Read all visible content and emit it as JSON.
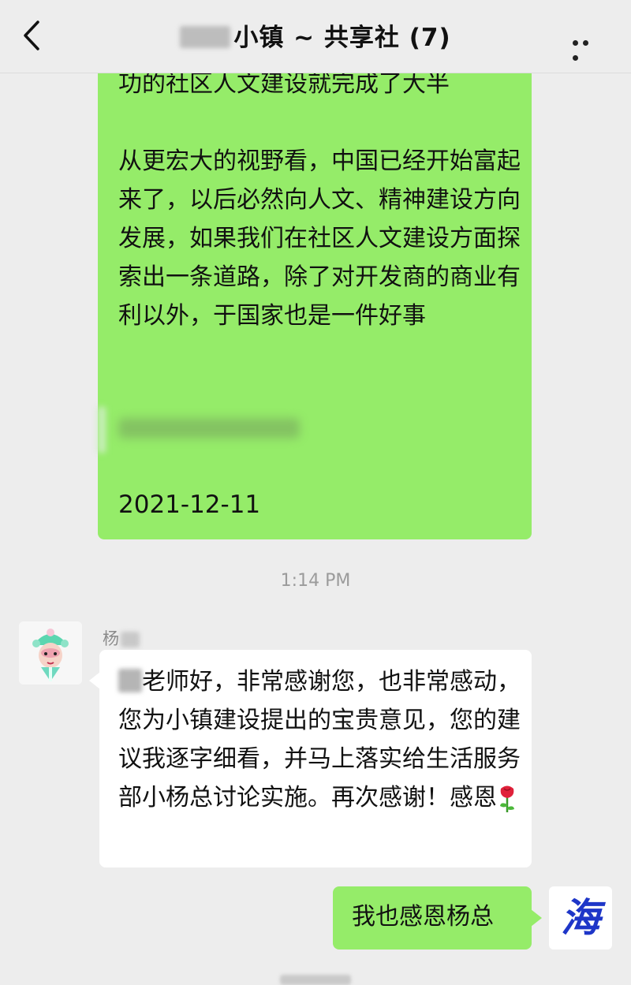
{
  "header": {
    "title": "小镇 ~ 共享社 (7)",
    "back_icon": "chevron-left-icon",
    "more_icon": "more-horizontal-icon"
  },
  "messages": {
    "forwarded": {
      "text": "功的社区人文建设就完成了大半\n\n从更宏大的视野看，中国已经开始富起来了，以后必然向人文、精神建设方向发展，如果我们在社区人文建设方面探索出一条道路，除了对开发商的商业有利以外，于国家也是一件好事",
      "date": "2021-12-11"
    },
    "time": "1:14 PM",
    "reply": {
      "sender": "杨",
      "text": "老师好，非常感谢您，也非常感动，您为小镇建设提出的宝贵意见，您的建议我逐字细看，并马上落实给生活服务部小杨总讨论实施。再次感谢！感恩",
      "emoji": "rose-icon"
    },
    "mine": {
      "text": "我也感恩杨总",
      "avatar_char": "海"
    }
  },
  "colors": {
    "background": "#ededed",
    "my_bubble": "#95ec69",
    "other_bubble": "#ffffff",
    "timestamp": "#9b9b9b",
    "avatar_char": "#1e36c8"
  }
}
